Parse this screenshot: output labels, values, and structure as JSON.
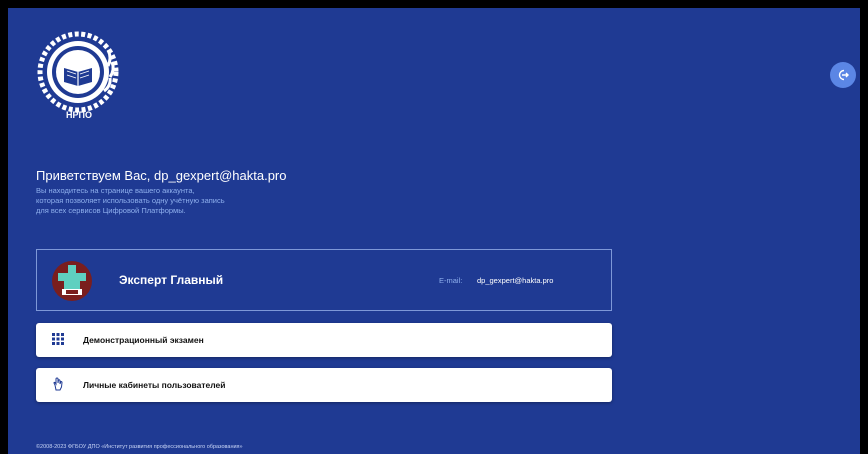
{
  "logo": {
    "text": "НРПО"
  },
  "header": {
    "logout_icon": "logout-icon"
  },
  "welcome": {
    "greeting": "Приветствуем Вас, dp_gexpert@hakta.pro",
    "info_line1": "Вы находитесь на странице вашего аккаунта,",
    "info_line2": "которая позволяет использовать одну учётную запись",
    "info_line3": "для всех сервисов Цифровой Платформы."
  },
  "profile": {
    "name": "Эксперт Главный",
    "email_label": "E-mail:",
    "email": "dp_gexpert@hakta.pro"
  },
  "services": [
    {
      "label": "Демонстрационный экзамен",
      "icon": "grid-icon"
    },
    {
      "label": "Личные кабинеты пользователей",
      "icon": "hand-icon"
    }
  ],
  "footer": {
    "text": "©2008-2023 ФГБОУ ДПО «Институт развития профессионального образования»"
  },
  "colors": {
    "background": "#1f3a93",
    "accent": "#5b86e5",
    "muted_text": "#8fb0ee"
  }
}
